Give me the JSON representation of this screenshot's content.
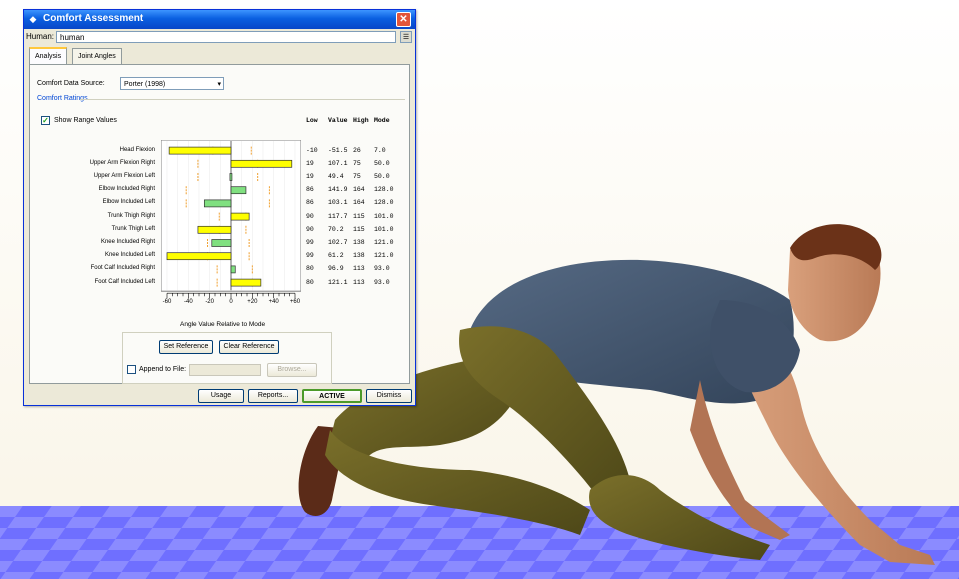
{
  "window": {
    "title": "Comfort Assessment",
    "close_glyph": "✕",
    "human_label": "Human:",
    "human_value": "human",
    "human_button": "☰"
  },
  "tabs": [
    "Analysis",
    "Joint Angles"
  ],
  "analysis": {
    "data_source_label": "Comfort Data Source:",
    "data_source_value": "Porter (1998)",
    "ratings_title": "Comfort Ratings",
    "show_range_label": "Show Range Values",
    "show_range_checked": true,
    "column_headers": [
      "Low",
      "Value",
      "High",
      "Mode"
    ],
    "axis_title": "Angle Value Relative to Mode",
    "set_reference": "Set Reference",
    "clear_reference": "Clear Reference",
    "append_label": "Append to File:",
    "append_checked": false,
    "browse": "Browse..."
  },
  "chart_data": {
    "type": "bar",
    "title": "",
    "xlabel": "Angle Value Relative to Mode",
    "xlim": [
      -60,
      60
    ],
    "xticks": [
      "-60",
      "-40",
      "-20",
      "0",
      "+20",
      "+40",
      "+60"
    ],
    "rows": [
      {
        "label": "Head Flexion",
        "low": "-10",
        "value": "-51.5",
        "high": "26",
        "mode": "7.0",
        "rel": -58,
        "color": "#ffff00",
        "range": [
          -17,
          19
        ]
      },
      {
        "label": "Upper Arm Flexion Right",
        "low": "19",
        "value": "107.1",
        "high": "75",
        "mode": "50.0",
        "rel": 57,
        "color": "#ffff00",
        "range": [
          -31,
          25
        ]
      },
      {
        "label": "Upper Arm Flexion Left",
        "low": "19",
        "value": "49.4",
        "high": "75",
        "mode": "50.0",
        "rel": -1,
        "color": "#80e080",
        "range": [
          -31,
          25
        ]
      },
      {
        "label": "Elbow Included Right",
        "low": "86",
        "value": "141.9",
        "high": "164",
        "mode": "128.0",
        "rel": 14,
        "color": "#80e080",
        "range": [
          -42,
          36
        ]
      },
      {
        "label": "Elbow Included Left",
        "low": "86",
        "value": "103.1",
        "high": "164",
        "mode": "128.0",
        "rel": -25,
        "color": "#80e080",
        "range": [
          -42,
          36
        ]
      },
      {
        "label": "Trunk Thigh Right",
        "low": "90",
        "value": "117.7",
        "high": "115",
        "mode": "101.0",
        "rel": 17,
        "color": "#ffff00",
        "range": [
          -11,
          14
        ]
      },
      {
        "label": "Trunk Thigh Left",
        "low": "90",
        "value": "70.2",
        "high": "115",
        "mode": "101.0",
        "rel": -31,
        "color": "#ffff00",
        "range": [
          -11,
          14
        ]
      },
      {
        "label": "Knee Included Right",
        "low": "99",
        "value": "102.7",
        "high": "138",
        "mode": "121.0",
        "rel": -18,
        "color": "#80e080",
        "range": [
          -22,
          17
        ]
      },
      {
        "label": "Knee Included Left",
        "low": "99",
        "value": "61.2",
        "high": "138",
        "mode": "121.0",
        "rel": -60,
        "color": "#ffff00",
        "range": [
          -22,
          17
        ]
      },
      {
        "label": "Foot Calf Included Right",
        "low": "80",
        "value": "96.9",
        "high": "113",
        "mode": "93.0",
        "rel": 4,
        "color": "#80e080",
        "range": [
          -13,
          20
        ]
      },
      {
        "label": "Foot Calf Included Left",
        "low": "80",
        "value": "121.1",
        "high": "113",
        "mode": "93.0",
        "rel": 28,
        "color": "#ffff00",
        "range": [
          -13,
          20
        ]
      }
    ]
  },
  "bottom_buttons": [
    "Usage",
    "Reports...",
    "ACTIVE",
    "Dismiss"
  ],
  "colors": {
    "bar_out_of_range": "#ffff00",
    "bar_in_range": "#80e080",
    "range_marker": "#f0a030",
    "floor": "#6b6bff"
  },
  "scene": {
    "figure": "human-model-crawling",
    "floor": "checkered-blue-floor"
  }
}
